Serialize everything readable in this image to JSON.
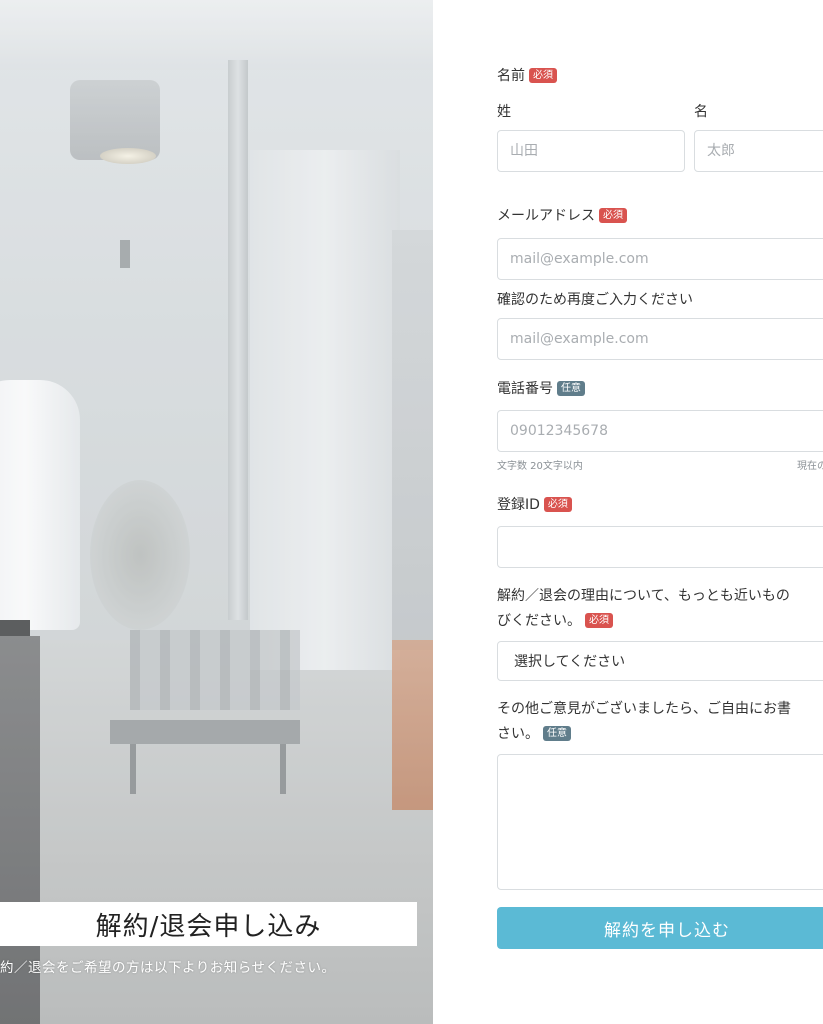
{
  "hero": {
    "title": "解約/退会申し込み",
    "subtitle": "約／退会をご希望の方は以下よりお知らせください。"
  },
  "form": {
    "name_label": "名前",
    "name_badge": "必須",
    "last_name_label": "姓",
    "first_name_label": "名",
    "last_name_placeholder": "山田",
    "first_name_placeholder": "太郎",
    "email_label": "メールアドレス",
    "email_badge": "必須",
    "email_placeholder": "mail@example.com",
    "email_confirm_label": "確認のため再度ご入力ください",
    "email_confirm_placeholder": "mail@example.com",
    "phone_label": "電話番号",
    "phone_badge": "任意",
    "phone_placeholder": "09012345678",
    "phone_hint_left": "文字数 20文字以内",
    "phone_hint_right": "現在の",
    "id_label": "登録ID",
    "id_badge": "必須",
    "id_value": "",
    "reason_label_line1": "解約／退会の理由について、もっとも近いもの",
    "reason_label_line2": "びください。",
    "reason_badge": "必須",
    "reason_selected": "選択してください",
    "comment_label_line1": "その他ご意見がございましたら、ご自由にお書",
    "comment_label_line2": "さい。",
    "comment_badge": "任意",
    "comment_value": "",
    "submit_label": "解約を申し込む"
  },
  "colors": {
    "required_badge": "#d9534f",
    "optional_badge": "#607d8b",
    "submit_button": "#5bbad5"
  }
}
